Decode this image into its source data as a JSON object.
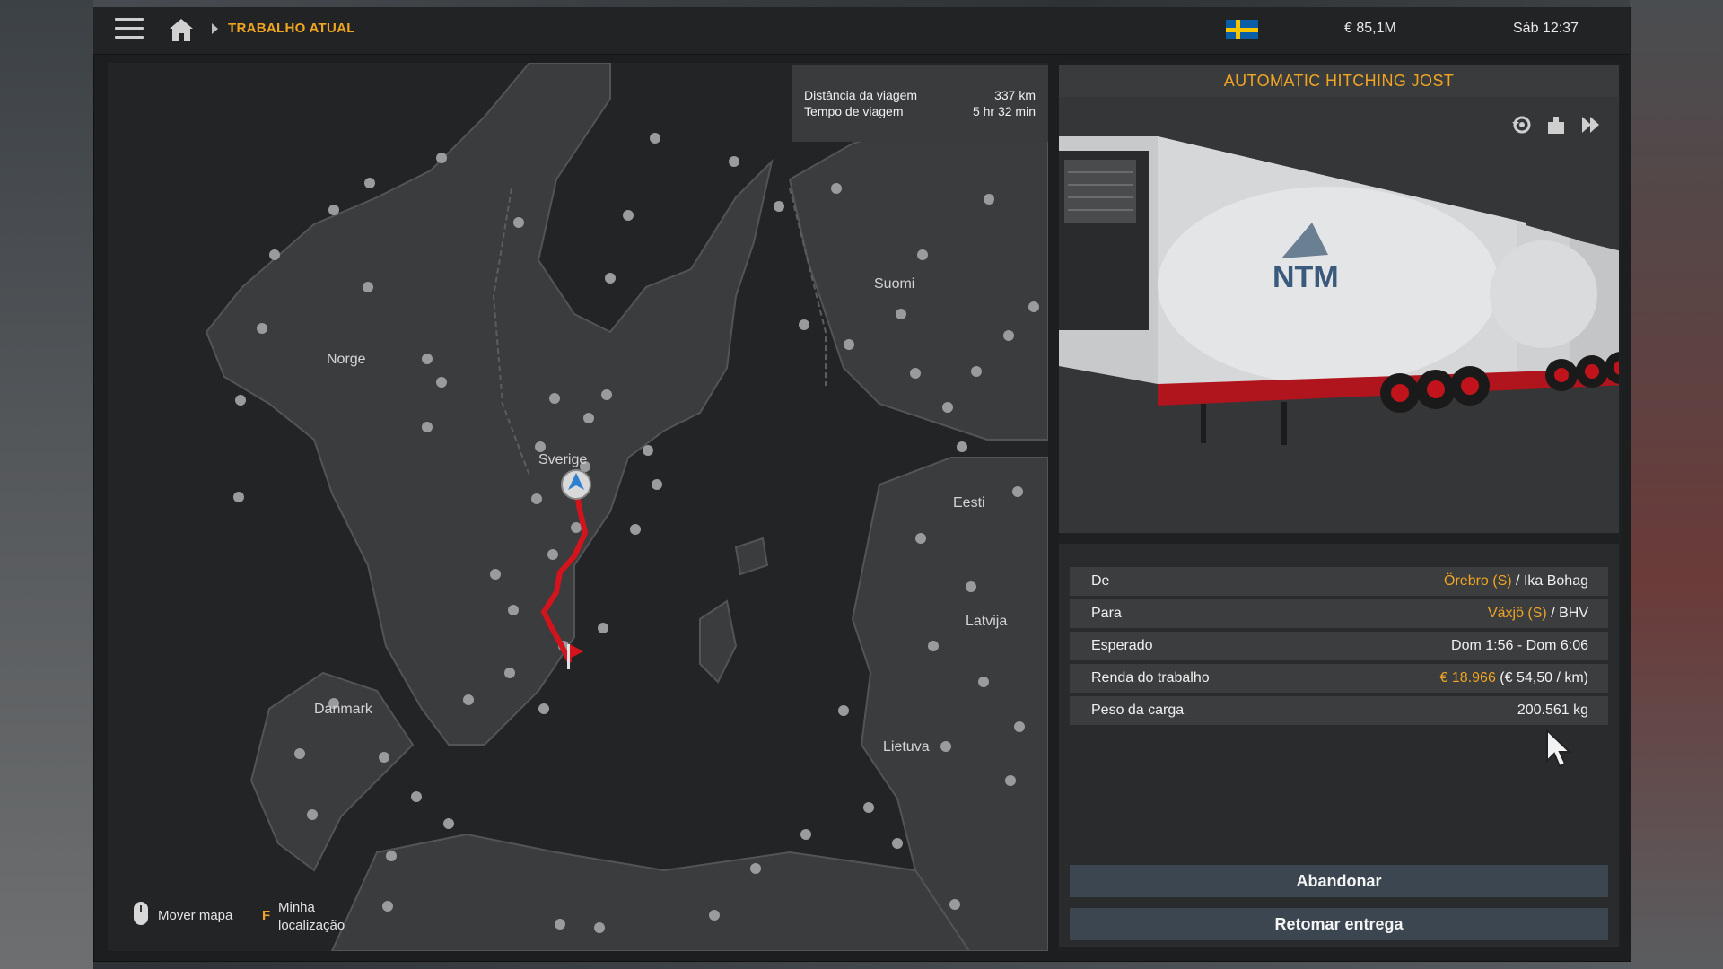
{
  "topbar": {
    "breadcrumb": "TRABALHO ATUAL",
    "money": "€ 85,1M",
    "time": "Sáb 12:37",
    "flag_colors": {
      "blue": "#0a5ea8",
      "yellow": "#f7c500"
    }
  },
  "icons": {
    "menu": "hamburger-icon",
    "home": "home-icon",
    "breadcrumb_arrow": "chevron-right-icon",
    "flag": "sweden-flag-icon",
    "mouse": "mouse-icon",
    "viewer_rotate": "rotate-view-icon",
    "viewer_camera": "camera-icon",
    "viewer_next": "fast-forward-icon"
  },
  "map": {
    "trip_distance_label": "Distância da viagem",
    "trip_distance_value": "337 km",
    "trip_time_label": "Tempo de viagem",
    "trip_time_value": "5 hr 32 min",
    "countries": {
      "norge": "Norge",
      "sverige": "Sverige",
      "suomi": "Suomi",
      "eesti": "Eesti",
      "latvija": "Latvija",
      "lietuva": "Lietuva",
      "danmark": "Danmark"
    },
    "hint_move": "Mover mapa",
    "hint_key": "F",
    "hint_location": "Minha localização",
    "route_color": "#d4141c"
  },
  "trailer": {
    "title": "AUTOMATIC HITCHING JOST",
    "brand": "NTM"
  },
  "job": {
    "from_label": "De",
    "from_city": "Örebro (S)",
    "from_company": "/ Ika Bohag",
    "to_label": "Para",
    "to_city": "Växjö (S)",
    "to_company": "/ BHV",
    "expected_label": "Esperado",
    "expected_value": "Dom 1:56 - Dom 6:06",
    "income_label": "Renda do trabalho",
    "income_value": "€ 18.966",
    "income_rate": "(€ 54,50 / km)",
    "weight_label": "Peso da carga",
    "weight_value": "200.561 kg"
  },
  "actions": {
    "abandon": "Abandonar",
    "resume": "Retomar entrega"
  },
  "colors": {
    "accent": "#f0a523",
    "button": "#3b4650"
  }
}
